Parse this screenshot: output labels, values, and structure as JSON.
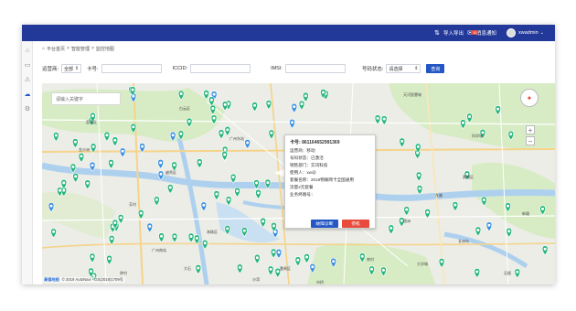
{
  "topbar": {
    "import_export": "导入导出",
    "notifications_label": "消息通知",
    "notification_count": "10",
    "username": "xwadmin"
  },
  "breadcrumb": [
    "平台首页",
    ">",
    "智能管理",
    ">",
    "监控地图"
  ],
  "filter": {
    "carrier_label": "运营商:",
    "carrier_value": "全部",
    "card_label": "卡号:",
    "card_value": "",
    "iccid_label": "ICCID:",
    "iccid_value": "",
    "imsi_label": "IMSI:",
    "imsi_value": "",
    "status_label": "号码状态:",
    "status_value": "请选择",
    "query_button": "查询"
  },
  "map": {
    "search_placeholder": "请输入关键字",
    "copyright_logo": "高德地图",
    "copyright_text": "© 2019 AutoNavi - GS(2018)1709号",
    "place_labels": [
      "荔湾区",
      "越秀区",
      "天河区",
      "海珠区",
      "番禺区",
      "白云区",
      "黄埔区",
      "广州东站",
      "猎德",
      "琶洲",
      "天河智慧城",
      "科学城",
      "大学城",
      "广州南站",
      "金沙洲",
      "芳村",
      "东圃",
      "新塘",
      "长洲岛",
      "市桥",
      "沙湾",
      "大石",
      "钟村",
      "南村",
      "石楼"
    ],
    "marker_color": "#26b57c",
    "marker_color_blue": "#3b8fe0"
  },
  "popup": {
    "card_label": "卡号:",
    "card_number": "861164652991369",
    "carrier_row": "运营商：移动",
    "status_row": "号码状态：已激活",
    "dept_row": "销售部门：实讯科技",
    "user_row": "使用人：xw@",
    "package_row": "套餐名称：2018物联网卡全国通用",
    "flow_row": "流量2元套餐",
    "terminal_row": "业务终端号：",
    "fault_button": "故障诊断",
    "stop_button": "停机"
  },
  "colors": {
    "topbar": "#23399a",
    "query_button": "#2457c5",
    "fault_button": "#2457c5",
    "stop_button": "#e84b3c"
  }
}
